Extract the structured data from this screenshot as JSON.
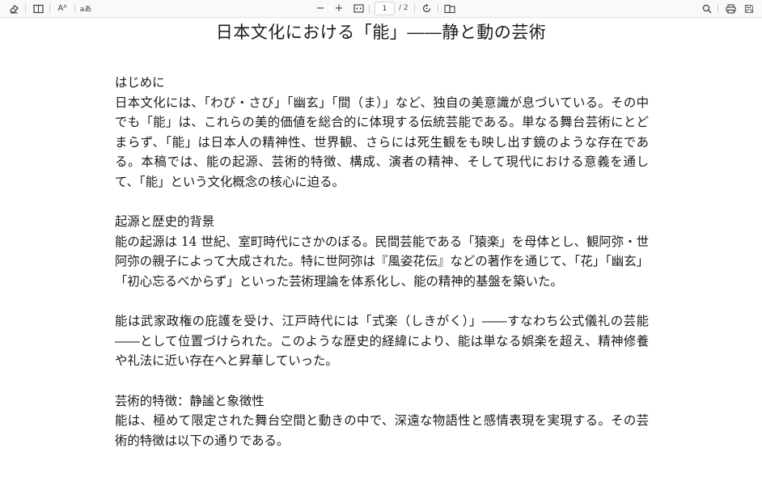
{
  "toolbar": {
    "left_icons": [
      "eraser-icon",
      "reader-view-icon",
      "text-size-icon",
      "translate-icon"
    ],
    "text_size_label": "Aᴬ",
    "translate_label": "aあ",
    "zoom_out_label": "−",
    "zoom_in_label": "+",
    "current_page": "1",
    "total_pages": "/ 2",
    "right_icons": [
      "search-icon",
      "print-icon",
      "save-icon"
    ]
  },
  "document": {
    "title": "日本文化における「能」――静と動の芸術",
    "sections": [
      {
        "heading": "はじめに",
        "paragraphs": [
          "日本文化には、「わび・さび」「幽玄」「間（ま）」など、独自の美意識が息づいている。その中でも「能」は、これらの美的価値を総合的に体現する伝統芸能である。単なる舞台芸術にとどまらず、「能」は日本人の精神性、世界観、さらには死生観をも映し出す鏡のような存在である。本稿では、能の起源、芸術的特徴、構成、演者の精神、そして現代における意義を通して、「能」という文化概念の核心に迫る。"
        ]
      },
      {
        "heading": "起源と歴史的背景",
        "paragraphs": [
          "能の起源は 14 世紀、室町時代にさかのぼる。民間芸能である「猿楽」を母体とし、観阿弥・世阿弥の親子によって大成された。特に世阿弥は『風姿花伝』などの著作を通じて、「花」「幽玄」「初心忘るべからず」といった芸術理論を体系化し、能の精神的基盤を築いた。",
          "能は武家政権の庇護を受け、江戸時代には「式楽（しきがく）」――すなわち公式儀礼の芸能――として位置づけられた。このような歴史的経緯により、能は単なる娯楽を超え、精神修養や礼法に近い存在へと昇華していった。"
        ]
      },
      {
        "heading": "芸術的特徴：静謐と象徴性",
        "paragraphs": [
          "能は、極めて限定された舞台空間と動きの中で、深遠な物語性と感情表現を実現する。その芸術的特徴は以下の通りである。"
        ]
      }
    ]
  }
}
